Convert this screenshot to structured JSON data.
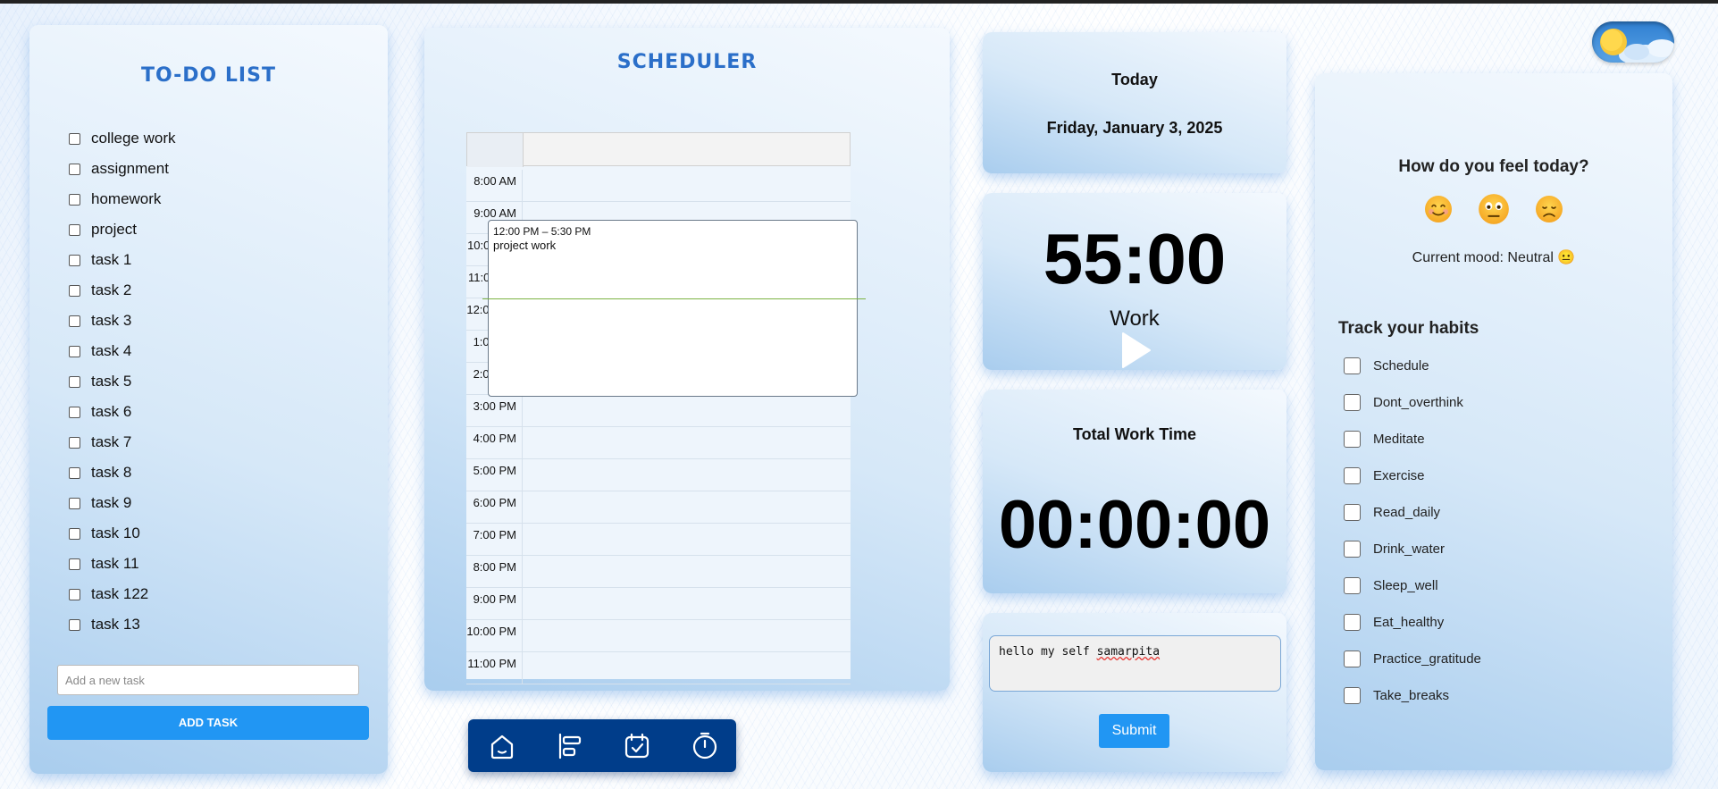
{
  "todo": {
    "title": "TO-DO LIST",
    "items": [
      "college work",
      "assignment",
      "homework",
      "project",
      "task 1",
      "task 2",
      "task 3",
      "task 4",
      "task 5",
      "task 6",
      "task 7",
      "task 8",
      "task 9",
      "task 10",
      "task 11",
      "task 122",
      "task 13"
    ],
    "input_placeholder": "Add a new task",
    "add_button": "ADD TASK"
  },
  "scheduler": {
    "title": "SCHEDULER",
    "times": [
      "8:00 AM",
      "9:00 AM",
      "10:00 AM",
      "11:00 AM",
      "12:00 PM",
      "1:00 PM",
      "2:00 PM",
      "3:00 PM",
      "4:00 PM",
      "5:00 PM",
      "6:00 PM",
      "7:00 PM",
      "8:00 PM",
      "9:00 PM",
      "10:00 PM",
      "11:00 PM"
    ],
    "event": {
      "time": "12:00 PM – 5:30 PM",
      "title": "project work"
    },
    "now_line_color": "#7cb342"
  },
  "toolbar": {
    "icons": [
      "home-icon",
      "timeline-icon",
      "calendar-check-icon",
      "timer-icon"
    ],
    "background": "#003d8a"
  },
  "today": {
    "label": "Today",
    "date": "Friday, January 3, 2025"
  },
  "timer": {
    "value": "55:00",
    "mode": "Work"
  },
  "total": {
    "label": "Total Work Time",
    "value": "00:00:00"
  },
  "note": {
    "text_before": "hello my self ",
    "text_misspelled": "samarpita",
    "submit": "Submit"
  },
  "mood": {
    "question": "How do you feel today?",
    "emojis": [
      "happy",
      "neutral",
      "sad"
    ],
    "current": "Current mood: Neutral 😐"
  },
  "habits": {
    "title": "Track your habits",
    "items": [
      "Schedule",
      "Dont_overthink",
      "Meditate",
      "Exercise",
      "Read_daily",
      "Drink_water",
      "Sleep_well",
      "Eat_healthy",
      "Practice_gratitude",
      "Take_breaks"
    ]
  },
  "colors": {
    "accent": "#2196f3",
    "title_blue": "#2b6fc9"
  }
}
